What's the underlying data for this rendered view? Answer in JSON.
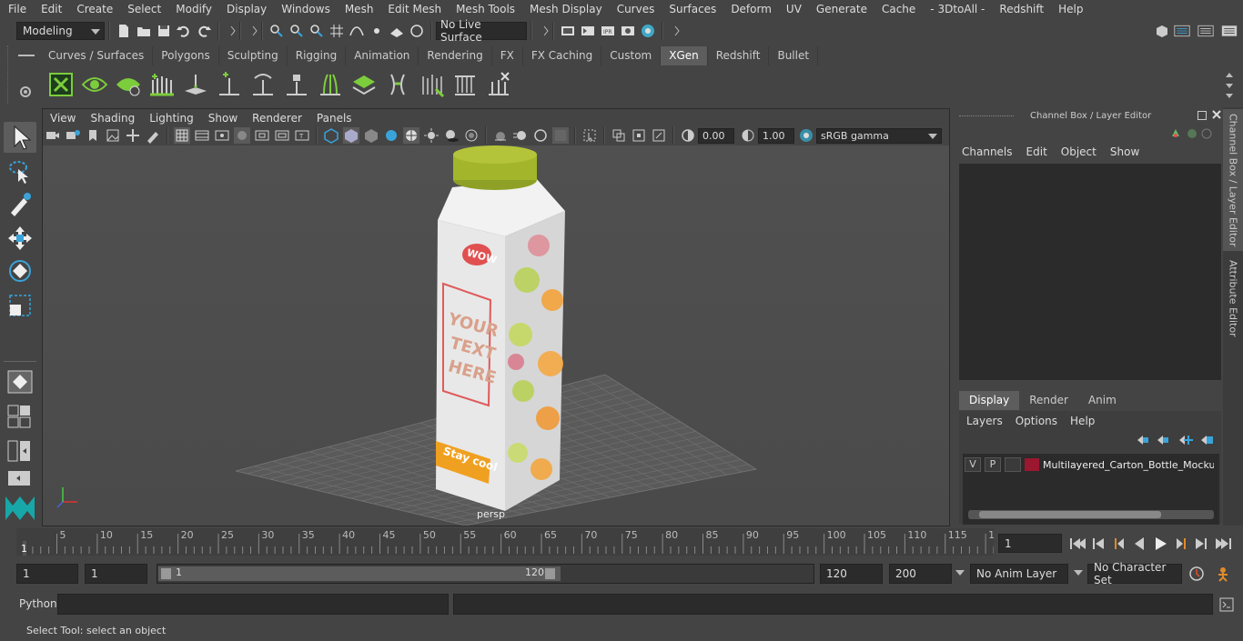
{
  "menubar": {
    "items": [
      "File",
      "Edit",
      "Create",
      "Select",
      "Modify",
      "Display",
      "Windows",
      "Mesh",
      "Edit Mesh",
      "Mesh Tools",
      "Mesh Display",
      "Curves",
      "Surfaces",
      "Deform",
      "UV",
      "Generate",
      "Cache",
      "- 3DtoAll -",
      "Redshift",
      "Help"
    ]
  },
  "statusline": {
    "mode": "Modeling",
    "live_surface": "No Live Surface"
  },
  "shelf": {
    "tabs": [
      "Curves / Surfaces",
      "Polygons",
      "Sculpting",
      "Rigging",
      "Animation",
      "Rendering",
      "FX",
      "FX Caching",
      "Custom",
      "XGen",
      "Redshift",
      "Bullet"
    ],
    "active_tab": "XGen"
  },
  "viewport": {
    "menu": [
      "View",
      "Shading",
      "Lighting",
      "Show",
      "Renderer",
      "Panels"
    ],
    "exposure": "0.00",
    "gamma": "1.00",
    "colorspace": "sRGB gamma",
    "camera_label": "persp",
    "product": {
      "badge": "WOW",
      "text_lines": [
        "YOUR",
        "TEXT",
        "HERE"
      ],
      "slogan": "Stay cool"
    }
  },
  "channelbox": {
    "title": "Channel Box / Layer Editor",
    "menu": [
      "Channels",
      "Edit",
      "Object",
      "Show"
    ]
  },
  "layereditor": {
    "tabs": [
      "Display",
      "Render",
      "Anim"
    ],
    "active_tab": "Display",
    "menu": [
      "Layers",
      "Options",
      "Help"
    ],
    "layers": [
      {
        "v": "V",
        "p": "P",
        "color": "#9b1730",
        "name": "Multilayered_Carton_Bottle_Mockup_"
      }
    ]
  },
  "sidetabs": [
    "Channel Box / Layer Editor",
    "Attribute Editor"
  ],
  "timeline": {
    "ticks": [
      "5",
      "10",
      "15",
      "20",
      "25",
      "30",
      "35",
      "40",
      "45",
      "50",
      "55",
      "60",
      "65",
      "70",
      "75",
      "80",
      "85",
      "90",
      "95",
      "100",
      "105",
      "110",
      "115",
      "12"
    ],
    "current_frame_marker": "1",
    "current_frame": "1"
  },
  "range": {
    "start": "1",
    "playback_start": "1",
    "slider_start": "1",
    "slider_end": "120",
    "playback_end": "120",
    "end": "200",
    "anim_layer": "No Anim Layer",
    "character_set": "No Character Set"
  },
  "cmdline": {
    "label": "Python"
  },
  "helpline": {
    "text": "Select Tool: select an object"
  },
  "colors": {
    "accent": "#5d5d5d",
    "cap": "#a3b52a",
    "slogan_bg": "#f0a020",
    "frame_red": "#e05a5a"
  }
}
